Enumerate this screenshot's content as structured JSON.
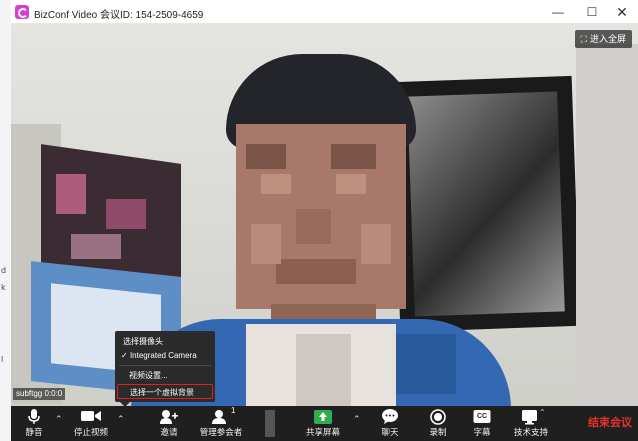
{
  "window": {
    "title": "BizConf Video 会议ID: 154-2509-4659",
    "controls": [
      "minimize-icon",
      "maximize-icon",
      "close-icon"
    ]
  },
  "left_strip": [
    "d",
    "k",
    "l"
  ],
  "video": {
    "fullscreen_label": "进入全屏",
    "username_tag": "subftgg 0:0:0"
  },
  "camera_menu": {
    "header": "选择摄像头",
    "camera_option": "Integrated Camera",
    "camera_checked": true,
    "video_settings": "视频设置...",
    "virtual_background": "选择一个虚拟背景"
  },
  "toolbar": {
    "mute_label": "静音",
    "stop_video_label": "停止视频",
    "invite_label": "邀请",
    "participants_label": "管理参会者",
    "participants_count": "1",
    "share_label": "共享屏幕",
    "chat_label": "聊天",
    "record_label": "录制",
    "subtitle_label": "字幕",
    "subtitle_icon_text": "CC",
    "support_label": "技术支持",
    "end_label": "结束会议"
  },
  "colors": {
    "accent_share": "#2fae4f",
    "end_meeting": "#e8312a",
    "menu_highlight_border": "#e0201b",
    "logo": "#d83fd0"
  }
}
